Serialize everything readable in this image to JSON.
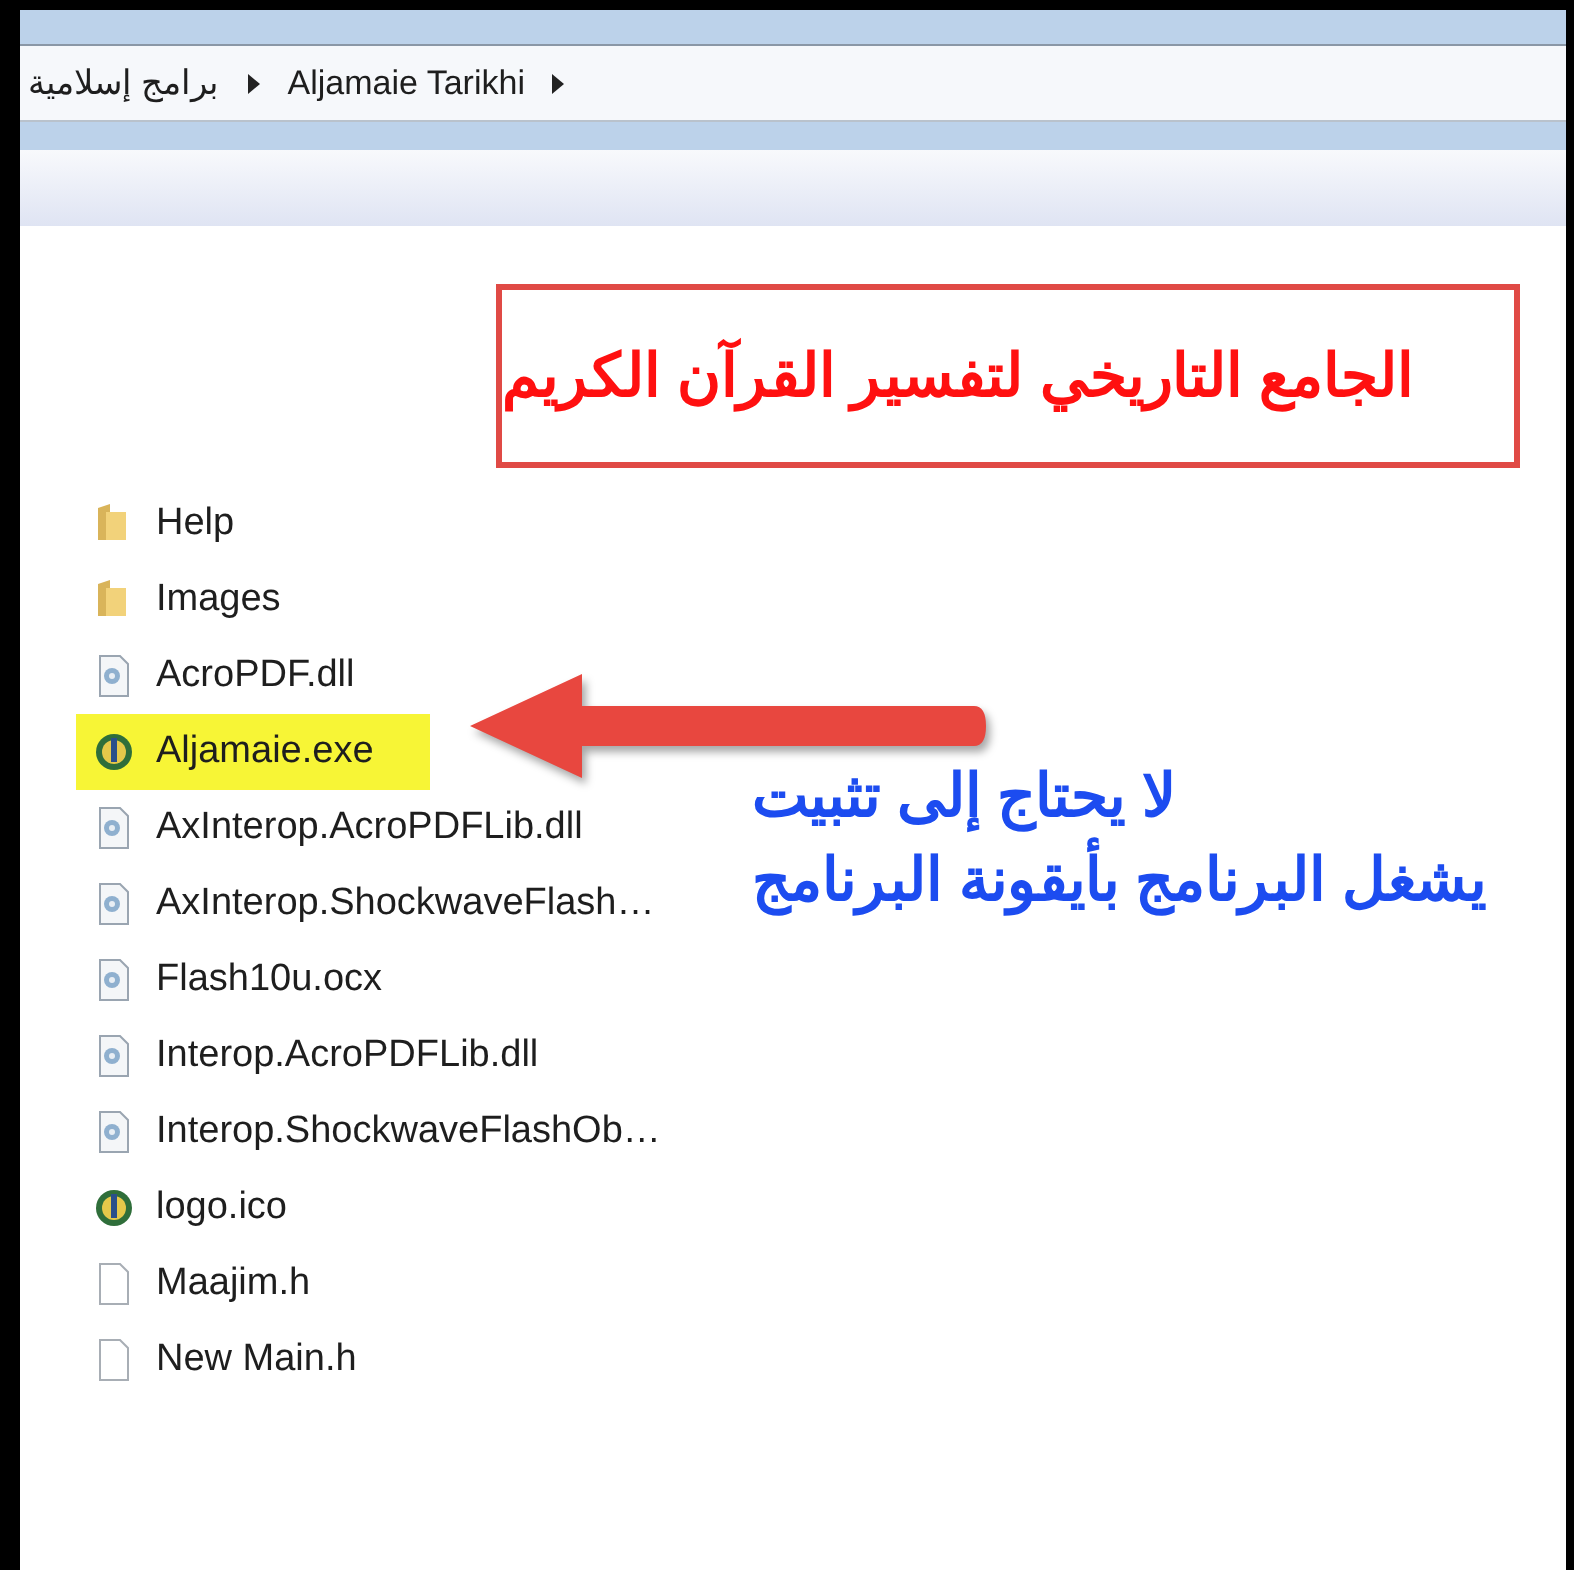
{
  "breadcrumb": [
    "برامج إسلامية",
    "Aljamaie Tarikhi"
  ],
  "files": [
    {
      "name": "Help",
      "kind": "folder",
      "selected": false
    },
    {
      "name": "Images",
      "kind": "folder",
      "selected": false
    },
    {
      "name": "AcroPDF.dll",
      "kind": "dll",
      "selected": false
    },
    {
      "name": "Aljamaie.exe",
      "kind": "app",
      "selected": true
    },
    {
      "name": "AxInterop.AcroPDFLib.dll",
      "kind": "dll",
      "selected": false
    },
    {
      "name": "AxInterop.ShockwaveFlash…",
      "kind": "dll",
      "selected": false
    },
    {
      "name": "Flash10u.ocx",
      "kind": "dll",
      "selected": false
    },
    {
      "name": "Interop.AcroPDFLib.dll",
      "kind": "dll",
      "selected": false
    },
    {
      "name": "Interop.ShockwaveFlashOb…",
      "kind": "dll",
      "selected": false
    },
    {
      "name": "logo.ico",
      "kind": "app",
      "selected": false
    },
    {
      "name": "Maajim.h",
      "kind": "file",
      "selected": false
    },
    {
      "name": "New Main.h",
      "kind": "file",
      "selected": false
    }
  ],
  "title_note": "الجامع التاريخي لتفسير القرآن الكريم",
  "notes": [
    "لا يحتاج إلى تثبيت",
    "يشغل البرنامج بأيقونة البرنامج"
  ]
}
